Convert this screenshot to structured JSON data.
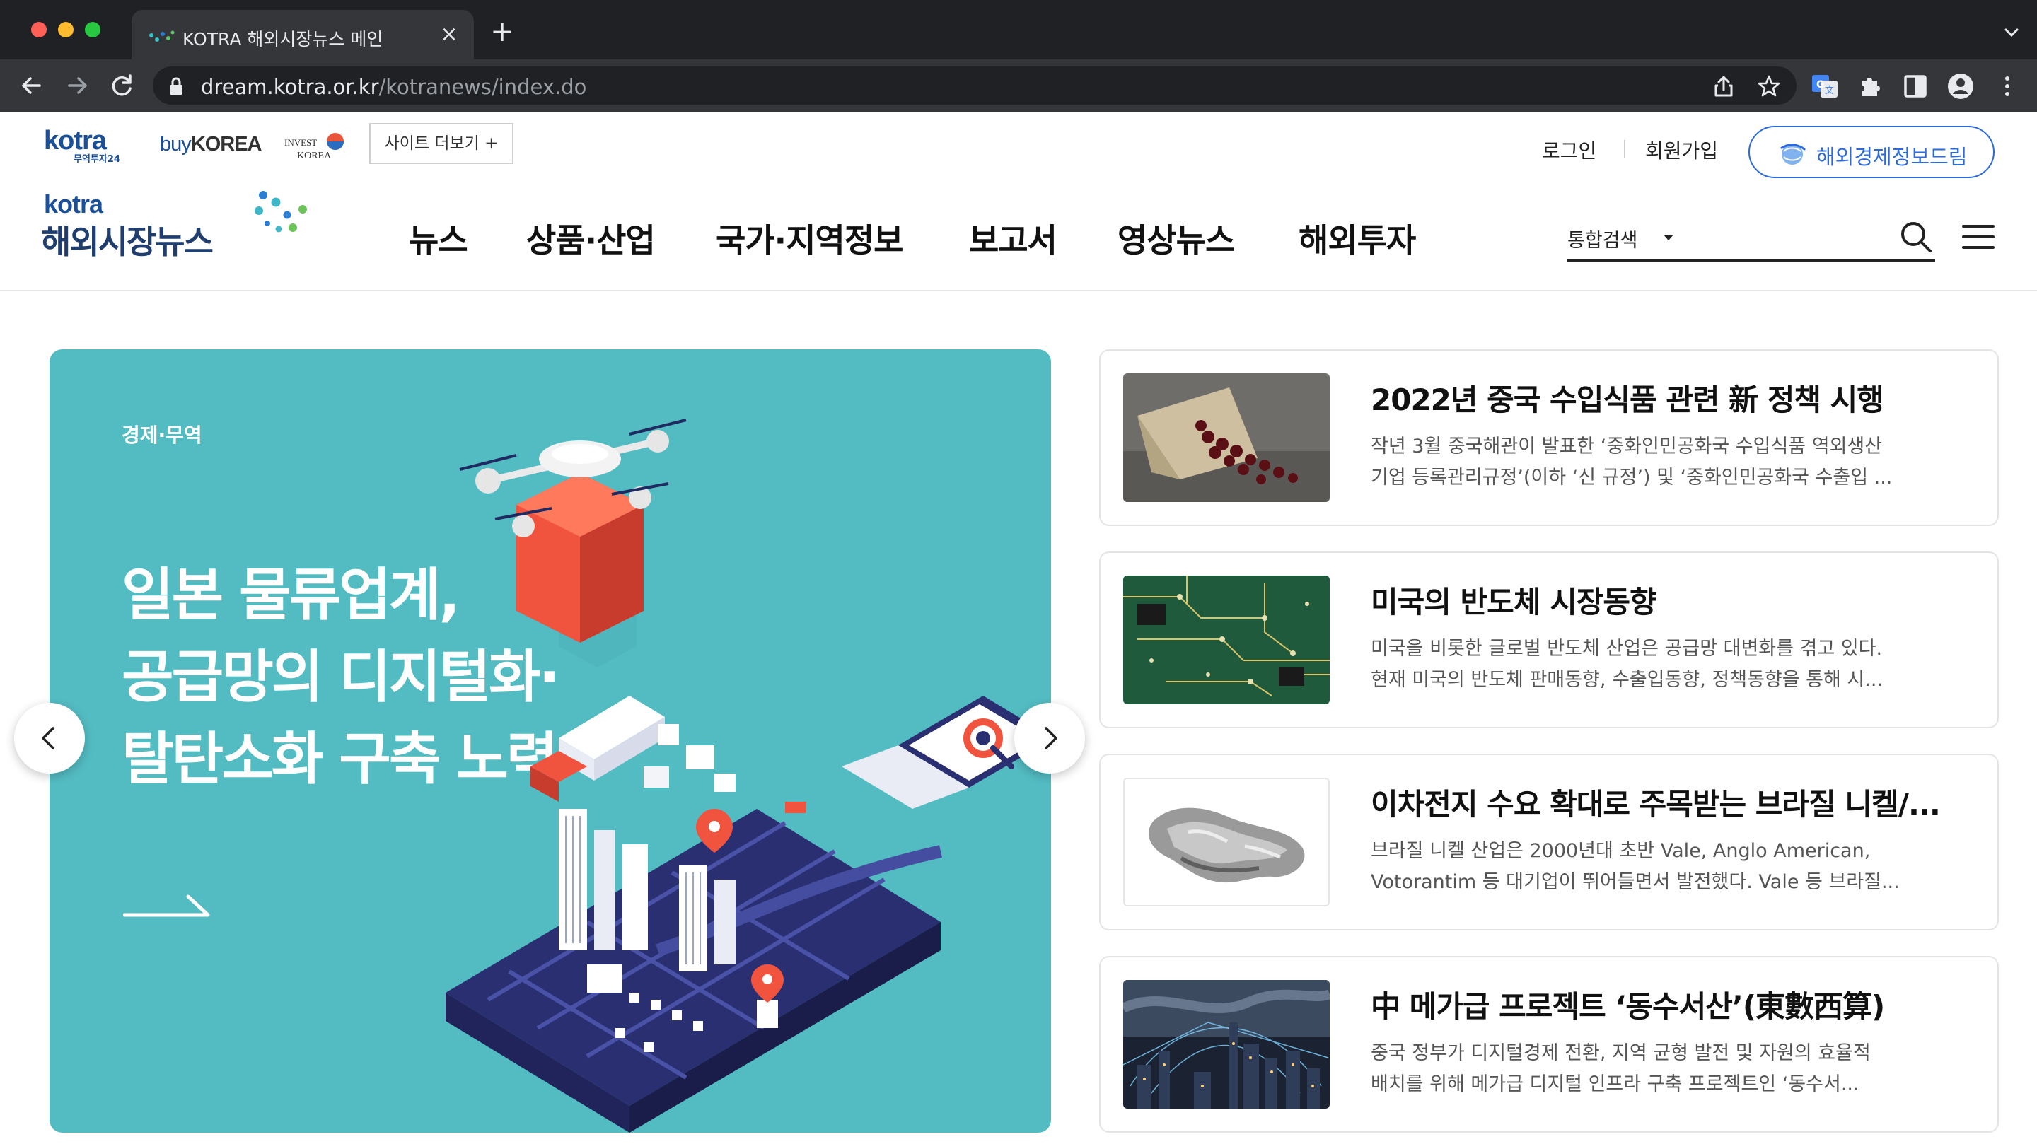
{
  "browser": {
    "tab_title": "KOTRA 해외시장뉴스 메인",
    "url_host": "dream.kotra.or.kr",
    "url_path": "/kotranews/index.do"
  },
  "header": {
    "logos": {
      "kotra_small": "kotra",
      "kotra_small_sub": "무역투자24",
      "buykorea_buy": "buy",
      "buykorea_korea": "KOREA",
      "investkorea": "INVEST KOREA"
    },
    "site_more_label": "사이트 더보기 +",
    "login_label": "로그인",
    "signup_label": "회원가입",
    "dream_label": "해외경제정보드림",
    "main_logo": {
      "kotra": "kotra",
      "title": "해외시장뉴스"
    },
    "nav": [
      "뉴스",
      "상품·산업",
      "국가·지역정보",
      "보고서",
      "영상뉴스",
      "해외투자"
    ],
    "search": {
      "scope": "통합검색",
      "placeholder": ""
    }
  },
  "hero": {
    "category": "경제·무역",
    "title_lines": [
      "일본 물류업계,",
      "공급망의 디지털화·",
      "탈탄소화 구축 노력"
    ],
    "bg_color": "#53bcc2"
  },
  "news": [
    {
      "title": "2022년 중국 수입식품 관련 新 정책 시행",
      "desc_lines": [
        "작년 3월 중국해관이 발표한 ‘중화인민공화국 수입식품 역외생산",
        "기업 등록관리규정’(이하 ‘신 규정’) 및 ‘중화인민공화국 수출입 ..."
      ],
      "thumb": "coffee-beans-bag"
    },
    {
      "title": "미국의 반도체 시장동향",
      "desc_lines": [
        "미국을 비롯한 글로벌 반도체 산업은 공급망 대변화를 겪고 있다.",
        "현재 미국의 반도체 판매동향, 수출입동향, 정책동향을 통해 시..."
      ],
      "thumb": "circuit-board"
    },
    {
      "title": "이차전지 수요 확대로 주목받는 브라질 니켈/...",
      "desc_lines": [
        "브라질 니켈 산업은 2000년대 초반 Vale, Anglo American,",
        "Votorantim 등 대기업이 뛰어들면서 발전했다. Vale 등 브라질..."
      ],
      "thumb": "nickel-ore"
    },
    {
      "title": "中 메가급 프로젝트 ‘동수서산’(東數西算)",
      "desc_lines": [
        "중국 정부가 디지털경제 전환, 지역 균형 발전 및 자원의 효율적",
        "배치를 위해 메가급 디지털 인프라 구축 프로젝트인 ‘동수서..."
      ],
      "thumb": "city-network"
    }
  ]
}
